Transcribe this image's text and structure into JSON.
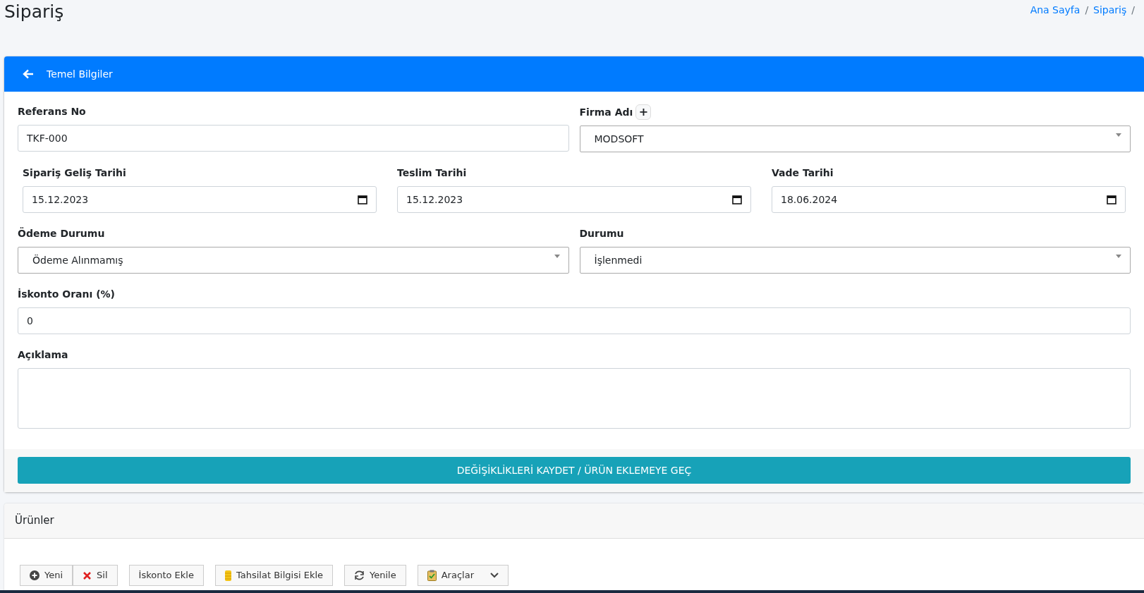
{
  "page_title": "Sipariş",
  "breadcrumb": [
    {
      "label": "Ana Sayfa",
      "separator": "/"
    },
    {
      "label": "Sipariş",
      "separator": "/"
    }
  ],
  "form_card": {
    "title": "Temel Bilgiler",
    "rows": [
      [
        {
          "label": "Referans No",
          "kind": "text",
          "value": "TKF-000"
        },
        {
          "label": "Firma Adı",
          "kind": "select",
          "value": "MODSOFT",
          "add_button": "+"
        }
      ],
      [
        {
          "label": "Sipariş Geliş Tarihi",
          "kind": "date",
          "value": "15.12.2023"
        },
        {
          "label": "Teslim Tarihi",
          "kind": "date",
          "value": "15.12.2023"
        },
        {
          "label": "Vade Tarihi",
          "kind": "date",
          "value": "18.06.2024"
        }
      ],
      [
        {
          "label": "Ödeme Durumu",
          "kind": "select",
          "value": "Ödeme Alınmamış"
        },
        {
          "label": "Durumu",
          "kind": "select",
          "value": "İşlenmedi"
        }
      ],
      [
        {
          "label": "İskonto Oranı (%)",
          "kind": "text",
          "value": "0"
        }
      ],
      [
        {
          "label": "Açıklama",
          "kind": "textarea"
        }
      ]
    ],
    "submit_button": "DEĞİŞİKLİKLERİ KAYDET / ÜRÜN EKLEMEYE GEÇ"
  },
  "products_card": {
    "title": "Ürünler",
    "toolbar": [
      {
        "label": "Yeni"
      },
      {
        "label": "Sil"
      },
      {
        "label": "İskonto Ekle"
      },
      {
        "label": "Tahsilat Bilgisi Ekle"
      },
      {
        "label": "Yenile"
      },
      {
        "label": "Araçlar"
      }
    ]
  }
}
